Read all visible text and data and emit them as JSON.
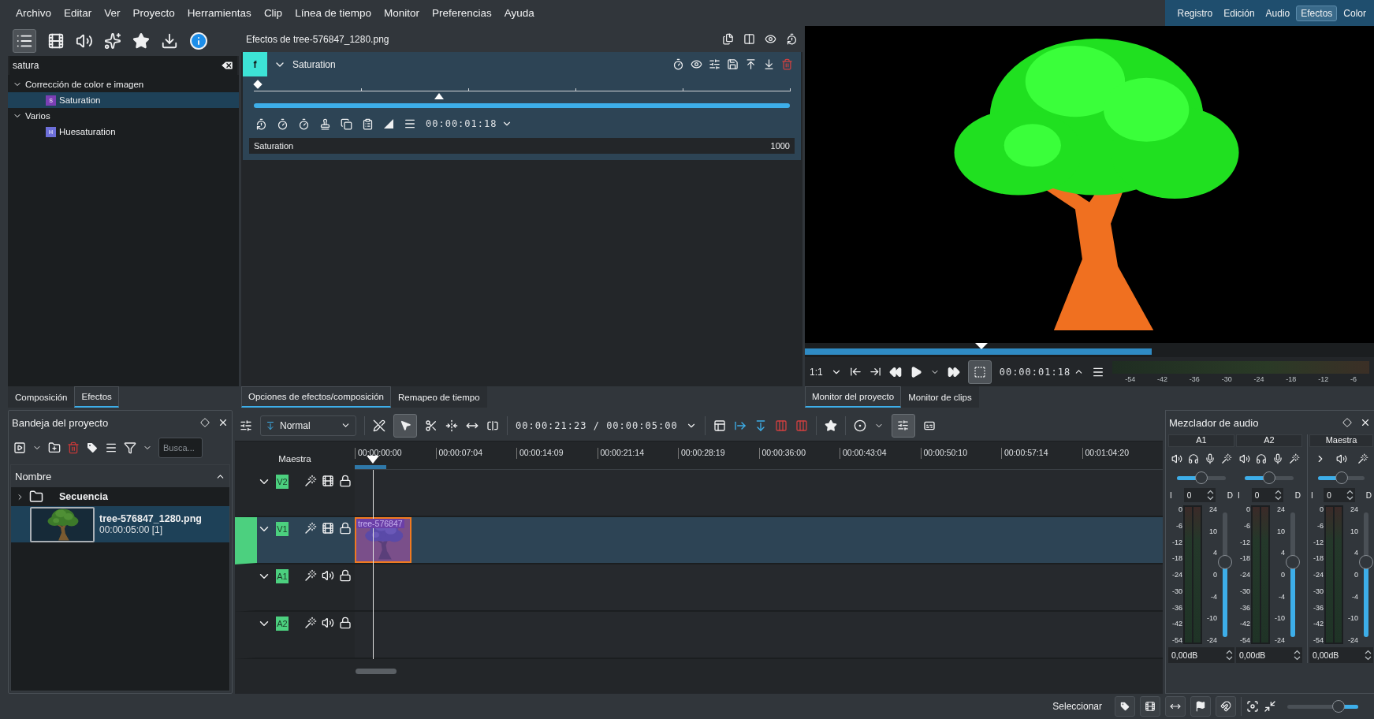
{
  "menu": [
    "Archivo",
    "Editar",
    "Ver",
    "Proyecto",
    "Herramientas",
    "Clip",
    "Línea de tiempo",
    "Monitor",
    "Preferencias",
    "Ayuda"
  ],
  "workspaces": [
    {
      "label": "Registro",
      "selected": false
    },
    {
      "label": "Edición",
      "selected": false
    },
    {
      "label": "Audio",
      "selected": false
    },
    {
      "label": "Efectos",
      "selected": true
    },
    {
      "label": "Color",
      "selected": false
    }
  ],
  "effects_browser": {
    "search": {
      "value": "satura"
    },
    "tree": [
      {
        "label": "Corrección de color e imagen",
        "expanded": true,
        "children": [
          {
            "label": "Saturation",
            "badge": "S",
            "color": "#7b3fb5",
            "selected": true
          }
        ]
      },
      {
        "label": "Varios",
        "expanded": true,
        "children": [
          {
            "label": "Huesaturation",
            "badge": "H",
            "color": "#6d6fd9",
            "selected": false
          }
        ]
      }
    ]
  },
  "effect_stack": {
    "title": "Efectos de tree-576847_1280.png",
    "effect": {
      "badge": "f",
      "name": "Saturation",
      "expanded": true,
      "level": 0.345,
      "timecode": "00:00:01:18",
      "parameter": {
        "name": "Saturation",
        "value": "1000"
      }
    }
  },
  "left_tabs": [
    {
      "label": "Composición",
      "selected": false
    },
    {
      "label": "Efectos",
      "selected": true
    }
  ],
  "center_tabs": [
    {
      "label": "Opciones de efectos/composición",
      "selected": true
    },
    {
      "label": "Remapeo de tiempo",
      "selected": false
    }
  ],
  "monitor": {
    "level": 0.61,
    "zoom": "1:1",
    "timecode": "00:00:01:18",
    "meter_scale": [
      "-54",
      "-42",
      "-36",
      "-30",
      "-24",
      "-18",
      "-12",
      "-6"
    ]
  },
  "monitor_tabs": [
    {
      "label": "Monitor del proyecto",
      "selected": true
    },
    {
      "label": "Monitor de clips",
      "selected": false
    }
  ],
  "project_bin": {
    "title": "Bandeja del proyecto",
    "search": {
      "placeholder": "Busca..."
    },
    "column": "Nombre",
    "items": [
      {
        "kind": "folder",
        "name": "Secuencia",
        "selected": false
      },
      {
        "kind": "clip",
        "name": "tree-576847_1280.png",
        "duration": "00:00:05:00 [1]",
        "selected": true
      }
    ]
  },
  "timeline": {
    "composite_mode": "Normal",
    "timecode": "00:00:21:23 / 00:00:05:00",
    "master_label": "Maestra",
    "ruler": [
      "00:00:00:00",
      "00:00:07:04",
      "00:00:14:09",
      "00:00:21:14",
      "00:00:28:19",
      "00:00:36:00",
      "00:00:43:04",
      "00:00:50:10",
      "00:00:57:14",
      "00:01:04:20"
    ],
    "tracks": [
      {
        "name": "V2",
        "kind": "video",
        "selected": false
      },
      {
        "name": "V1",
        "kind": "video",
        "selected": true,
        "clip": {
          "label": "tree-576847"
        }
      },
      {
        "name": "A1",
        "kind": "audio",
        "selected": false
      },
      {
        "name": "A2",
        "kind": "audio",
        "selected": false
      }
    ]
  },
  "mixer": {
    "title": "Mezclador de audio",
    "channels": [
      {
        "name": "A1",
        "kind": "track",
        "left": "I",
        "balance": "0",
        "right": "D",
        "balance_slider": {
          "level": 0.5
        },
        "fader": {
          "level": 0.6
        },
        "gain": "0,00dB",
        "db_scale": [
          "0",
          "-6",
          "-12",
          "-18",
          "-24",
          "-30",
          "-36",
          "-42",
          "-54"
        ],
        "gain_scale": [
          "24",
          "10",
          "4",
          "0",
          "-4",
          "-10",
          "-24"
        ]
      },
      {
        "name": "A2",
        "kind": "track",
        "left": "I",
        "balance": "0",
        "right": "D",
        "balance_slider": {
          "level": 0.5
        },
        "fader": {
          "level": 0.6
        },
        "gain": "0,00dB",
        "db_scale": [
          "0",
          "-6",
          "-12",
          "-18",
          "-24",
          "-30",
          "-36",
          "-42",
          "-54"
        ],
        "gain_scale": [
          "24",
          "10",
          "4",
          "0",
          "-4",
          "-10",
          "-24"
        ]
      },
      {
        "name": "Maestra",
        "kind": "master",
        "left": "I",
        "balance": "0",
        "right": "D",
        "balance_slider": {
          "level": 0.5
        },
        "fader": {
          "level": 0.6
        },
        "gain": "0,00dB",
        "db_scale": [
          "0",
          "-6",
          "-12",
          "-18",
          "-24",
          "-30",
          "-36",
          "-42",
          "-54"
        ],
        "gain_scale": [
          "24",
          "10",
          "4",
          "0",
          "-4",
          "-10",
          "-24"
        ]
      }
    ]
  },
  "status_bar": {
    "tool": "Seleccionar",
    "zoom": {
      "level": 0.72
    }
  }
}
